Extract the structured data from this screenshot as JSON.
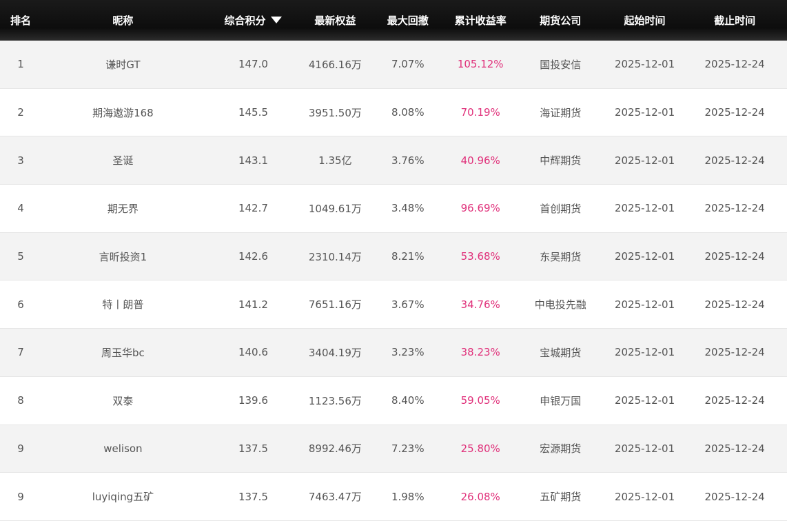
{
  "columns": [
    "排名",
    "昵称",
    "综合积分",
    "最新权益",
    "最大回撤",
    "累计收益率",
    "期货公司",
    "起始时间",
    "截止时间"
  ],
  "sort_icon": "caret-down-icon",
  "return_color": "#e0307a",
  "rows": [
    [
      "1",
      "谦时GT",
      "147.0",
      "4166.16万",
      "7.07%",
      "105.12%",
      "国投安信",
      "2025-12-01",
      "2025-12-24"
    ],
    [
      "2",
      "期海遨游168",
      "145.5",
      "3951.50万",
      "8.08%",
      "70.19%",
      "海证期货",
      "2025-12-01",
      "2025-12-24"
    ],
    [
      "3",
      "圣诞",
      "143.1",
      "1.35亿",
      "3.76%",
      "40.96%",
      "中辉期货",
      "2025-12-01",
      "2025-12-24"
    ],
    [
      "4",
      "期无界",
      "142.7",
      "1049.61万",
      "3.48%",
      "96.69%",
      "首创期货",
      "2025-12-01",
      "2025-12-24"
    ],
    [
      "5",
      "言昕投资1",
      "142.6",
      "2310.14万",
      "8.21%",
      "53.68%",
      "东吴期货",
      "2025-12-01",
      "2025-12-24"
    ],
    [
      "6",
      "特丨朗普",
      "141.2",
      "7651.16万",
      "3.67%",
      "34.76%",
      "中电投先融",
      "2025-12-01",
      "2025-12-24"
    ],
    [
      "7",
      "周玉华bc",
      "140.6",
      "3404.19万",
      "3.23%",
      "38.23%",
      "宝城期货",
      "2025-12-01",
      "2025-12-24"
    ],
    [
      "8",
      "双泰",
      "139.6",
      "1123.56万",
      "8.40%",
      "59.05%",
      "申银万国",
      "2025-12-01",
      "2025-12-24"
    ],
    [
      "9",
      "welison",
      "137.5",
      "8992.46万",
      "7.23%",
      "25.80%",
      "宏源期货",
      "2025-12-01",
      "2025-12-24"
    ],
    [
      "9",
      "luyiqing五矿",
      "137.5",
      "7463.47万",
      "1.98%",
      "26.08%",
      "五矿期货",
      "2025-12-01",
      "2025-12-24"
    ]
  ]
}
